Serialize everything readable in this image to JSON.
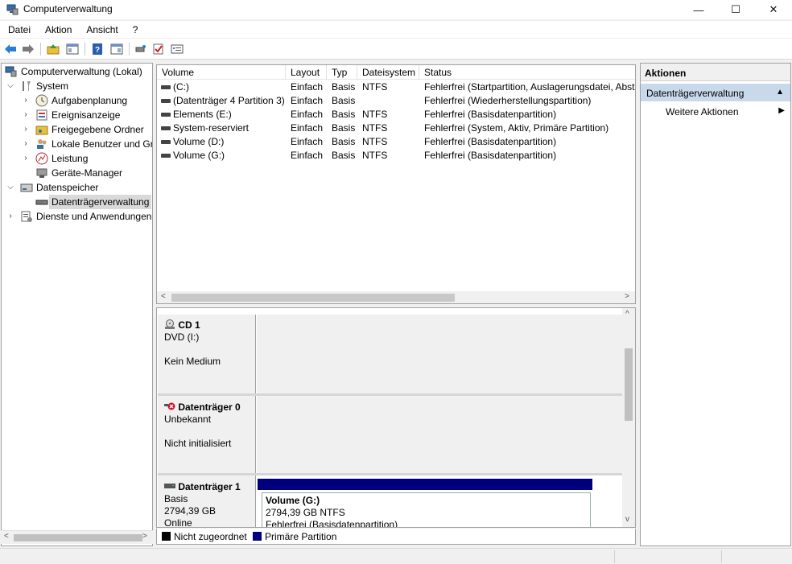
{
  "window": {
    "title": "Computerverwaltung",
    "minimize_glyph": "—",
    "maximize_glyph": "☐",
    "close_glyph": "✕"
  },
  "menu": [
    "Datei",
    "Aktion",
    "Ansicht",
    "?"
  ],
  "toolbar": {
    "icons": [
      "back-icon",
      "forward-icon",
      "up-folder-icon",
      "show-hide-tree-icon",
      "help-icon",
      "show-hide-action-pane-icon",
      "connect-icon",
      "check-icon",
      "properties-icon"
    ]
  },
  "tree": {
    "root": "Computerverwaltung (Lokal)",
    "system": "System",
    "aufgabenplanung": "Aufgabenplanung",
    "ereignisanzeige": "Ereignisanzeige",
    "freigegebene_ordner": "Freigegebene Ordner",
    "lokale_benutzer": "Lokale Benutzer und Gruppen",
    "leistung": "Leistung",
    "geraete_manager": "Geräte-Manager",
    "datenspeicher": "Datenspeicher",
    "datentraegerverwaltung": "Datenträgerverwaltung",
    "dienste": "Dienste und Anwendungen"
  },
  "volume_list": {
    "columns": [
      "Volume",
      "Layout",
      "Typ",
      "Dateisystem",
      "Status"
    ],
    "rows": [
      {
        "volume": "(C:)",
        "layout": "Einfach",
        "typ": "Basis",
        "fs": "NTFS",
        "status": "Fehlerfrei (Startpartition, Auslagerungsdatei, Absturzabbild, Primäre Partition)"
      },
      {
        "volume": "(Datenträger 4 Partition 3)",
        "layout": "Einfach",
        "typ": "Basis",
        "fs": "",
        "status": "Fehlerfrei (Wiederherstellungspartition)"
      },
      {
        "volume": "Elements (E:)",
        "layout": "Einfach",
        "typ": "Basis",
        "fs": "NTFS",
        "status": "Fehlerfrei (Basisdatenpartition)"
      },
      {
        "volume": "System-reserviert",
        "layout": "Einfach",
        "typ": "Basis",
        "fs": "NTFS",
        "status": "Fehlerfrei (System, Aktiv, Primäre Partition)"
      },
      {
        "volume": "Volume (D:)",
        "layout": "Einfach",
        "typ": "Basis",
        "fs": "NTFS",
        "status": "Fehlerfrei (Basisdatenpartition)"
      },
      {
        "volume": "Volume (G:)",
        "layout": "Einfach",
        "typ": "Basis",
        "fs": "NTFS",
        "status": "Fehlerfrei (Basisdatenpartition)"
      }
    ]
  },
  "disks": {
    "cd1": {
      "name": "CD 1",
      "line1": "DVD (I:)",
      "line2": "Kein Medium"
    },
    "disk0": {
      "name": "Datenträger 0",
      "line1": "Unbekannt",
      "line2": "Nicht initialisiert"
    },
    "disk1": {
      "name": "Datenträger 1",
      "line1": "Basis",
      "line2": "2794,39 GB",
      "line3": "Online"
    },
    "volume_g": {
      "title": "Volume  (G:)",
      "size": "2794,39 GB NTFS",
      "status": "Fehlerfrei (Basisdatenpartition)"
    }
  },
  "legend": {
    "unallocated": "Nicht zugeordnet",
    "primary": "Primäre Partition",
    "unallocated_color": "#000000",
    "primary_color": "#00007c"
  },
  "actions": {
    "header": "Aktionen",
    "section": "Datenträgerverwaltung",
    "item": "Weitere Aktionen"
  },
  "scroll_glyphs": {
    "left": "<",
    "right": ">",
    "up": "^",
    "down": "v"
  }
}
